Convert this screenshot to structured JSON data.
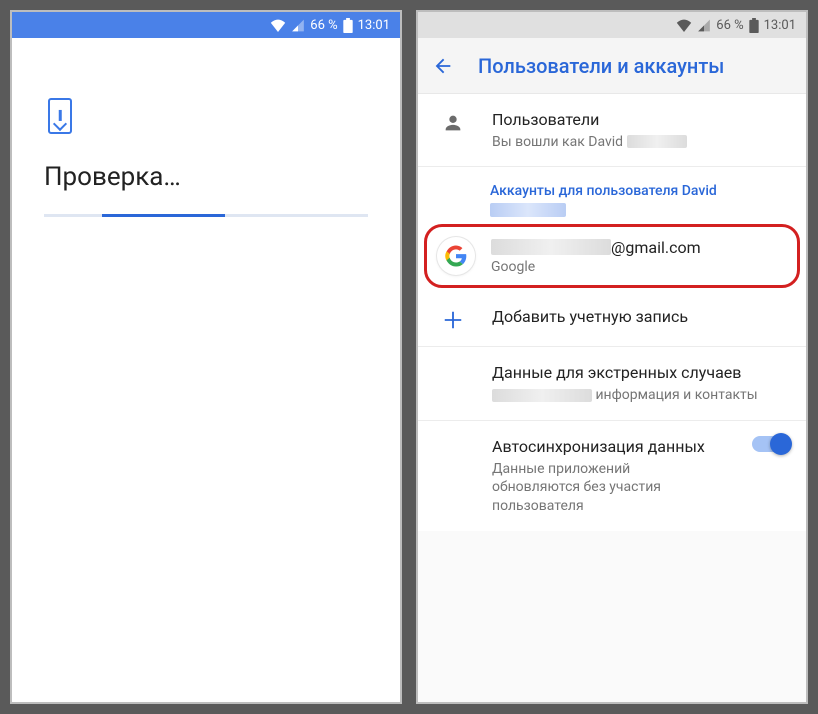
{
  "status": {
    "battery_pct": "66 %",
    "time": "13:01"
  },
  "left": {
    "title": "Проверка…"
  },
  "right": {
    "appbar_title": "Пользователи и аккаунты",
    "users": {
      "title": "Пользователи",
      "subtitle_prefix": "Вы вошли как David "
    },
    "accounts_header_prefix": "Аккаунты для пользователя David",
    "google_account": {
      "email_suffix": "@gmail.com",
      "provider": "Google"
    },
    "add_account": "Добавить учетную запись",
    "emergency": {
      "title": "Данные для экстренных случаев",
      "subtitle_suffix": " информация и контакты"
    },
    "autosync": {
      "title": "Автосинхронизация данных",
      "subtitle": "Данные приложений обновляются без участия пользователя",
      "enabled": true
    }
  }
}
